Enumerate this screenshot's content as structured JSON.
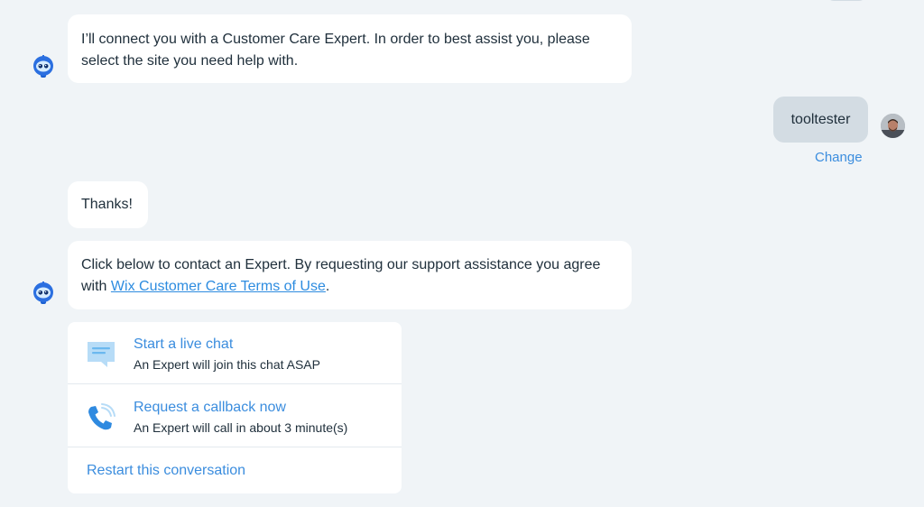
{
  "messages": {
    "connect_text": "I’ll connect you with a Customer Care Expert. In order to best assist you, please select the site you need help with.",
    "thanks_text": "Thanks!",
    "contact_prefix": "Click below to contact an Expert. By requesting our support assistance you agree with ",
    "terms_link": "Wix Customer Care Terms of Use",
    "contact_suffix": "."
  },
  "user_reply": {
    "text": "tooltester",
    "change_label": "Change"
  },
  "options": {
    "live_chat": {
      "title": "Start a live chat",
      "subtitle": "An Expert will join this chat ASAP",
      "icon": "chat-bubble-icon"
    },
    "callback": {
      "title": "Request a callback now",
      "subtitle": "An Expert will call in about 3 minute(s)",
      "icon": "phone-icon"
    },
    "restart_label": "Restart this conversation"
  },
  "colors": {
    "background": "#f0f4f7",
    "link": "#3b8dde",
    "user_bubble": "#d3dce3",
    "text": "#20303c"
  }
}
